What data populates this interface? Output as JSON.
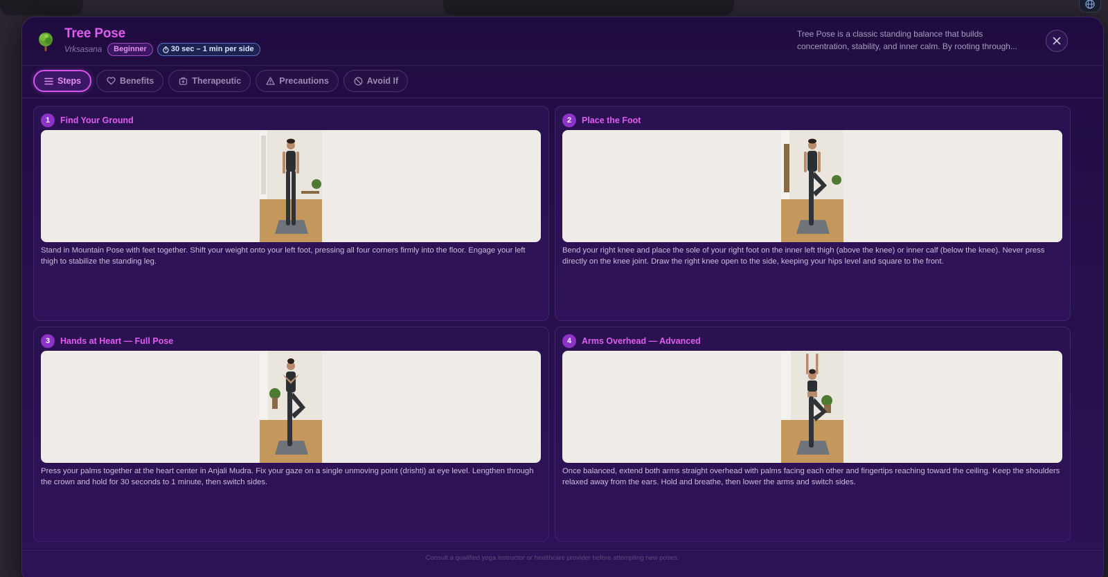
{
  "modal": {
    "title": "Tree Pose",
    "sanskrit": "Vrksasana",
    "level": "Beginner",
    "duration": "30 sec – 1 min per side",
    "description": "Tree Pose is a classic standing balance that builds concentration, stability, and inner calm. By rooting through..."
  },
  "tabs": [
    {
      "label": "Steps",
      "icon": "list-icon",
      "active": true
    },
    {
      "label": "Benefits",
      "icon": "heart-icon",
      "active": false
    },
    {
      "label": "Therapeutic",
      "icon": "medical-kit-icon",
      "active": false
    },
    {
      "label": "Precautions",
      "icon": "warning-icon",
      "active": false
    },
    {
      "label": "Avoid If",
      "icon": "ban-icon",
      "active": false
    }
  ],
  "steps": [
    {
      "number": "1",
      "title": "Find Your Ground",
      "image": "mountain-pose-photo",
      "text": "Stand in Mountain Pose with feet together. Shift your weight onto your left foot, pressing all four corners firmly into the floor. Engage your left thigh to stabilize the standing leg."
    },
    {
      "number": "2",
      "title": "Place the Foot",
      "image": "foot-placement-photo",
      "text": "Bend your right knee and place the sole of your right foot on the inner left thigh (above the knee) or inner calf (below the knee). Never press directly on the knee joint. Draw the right knee open to the side, keeping your hips level and square to the front."
    },
    {
      "number": "3",
      "title": "Hands at Heart — Full Pose",
      "image": "hands-at-heart-photo",
      "text": "Press your palms together at the heart center in Anjali Mudra. Fix your gaze on a single unmoving point (drishti) at eye level. Lengthen through the crown and hold for 30 seconds to 1 minute, then switch sides."
    },
    {
      "number": "4",
      "title": "Arms Overhead — Advanced",
      "image": "arms-overhead-photo",
      "text": "Once balanced, extend both arms straight overhead with palms facing each other and fingertips reaching toward the ceiling. Keep the shoulders relaxed away from the ears. Hold and breathe, then lower the arms and switch sides."
    }
  ],
  "footer": "Consult a qualified yoga instructor or healthcare provider before attempting new poses.",
  "colors": {
    "accent": "#e05cf0",
    "modal_bg": "#26104c",
    "step_number_bg": "#8e33c7",
    "image_bg": "#efece8"
  }
}
